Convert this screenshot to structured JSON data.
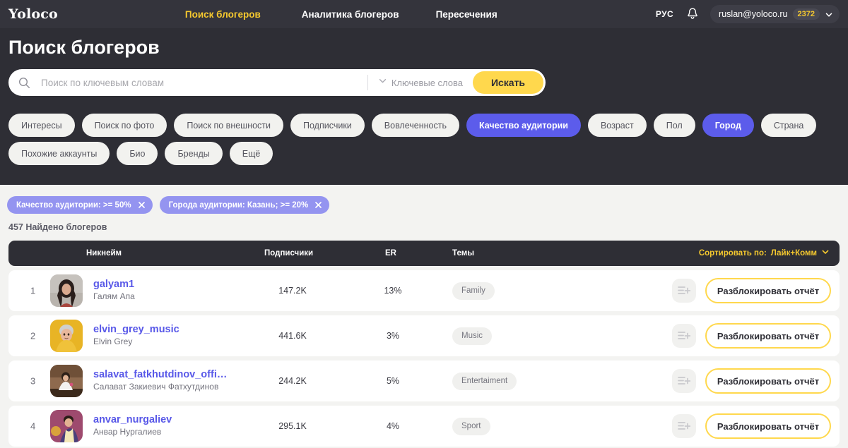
{
  "navbar": {
    "logo": "Yoloco",
    "links": [
      {
        "label": "Поиск блогеров",
        "active": true
      },
      {
        "label": "Аналитика блогеров",
        "active": false
      },
      {
        "label": "Пересечения",
        "active": false
      }
    ],
    "lang": "РУС",
    "bell_icon": "bell-icon",
    "user_email": "ruslan@yoloco.ru",
    "credits": "2372",
    "chevron_icon": "chevron-down-icon"
  },
  "page": {
    "title": "Поиск блогеров",
    "accent_yellow": "#ffd84d",
    "accent_purple": "#5c5ceb",
    "dark_bg": "#2e2e35",
    "page_bg": "#f3f3f1",
    "link_color": "#5858e8"
  },
  "search": {
    "icon": "search-icon",
    "placeholder": "Поиск по ключевым словам",
    "value": "",
    "keyword_select_label": "Ключевые слова",
    "keyword_select_icon": "chevron-down-icon",
    "button_label": "Искать"
  },
  "filters": {
    "row1": [
      {
        "label": "Интересы",
        "active": false
      },
      {
        "label": "Поиск по фото",
        "active": false
      },
      {
        "label": "Поиск по внешности",
        "active": false
      },
      {
        "label": "Подписчики",
        "active": false
      },
      {
        "label": "Вовлеченность",
        "active": false
      },
      {
        "label": "Качество аудитории",
        "active": true
      },
      {
        "label": "Возраст",
        "active": false
      },
      {
        "label": "Пол",
        "active": false
      },
      {
        "label": "Город",
        "active": true
      },
      {
        "label": "Страна",
        "active": false
      }
    ],
    "row2": [
      {
        "label": "Похожие аккаунты",
        "active": false
      },
      {
        "label": "Био",
        "active": false
      },
      {
        "label": "Бренды",
        "active": false
      },
      {
        "label": "Ещё",
        "active": false
      }
    ]
  },
  "applied_tags": [
    {
      "label": "Качество аудитории: >= 50%",
      "remove_icon": "close-icon"
    },
    {
      "label": "Города аудитории: Казань; >= 20%",
      "remove_icon": "close-icon"
    }
  ],
  "results": {
    "count_text": "457 Найдено блогеров",
    "columns": {
      "nickname": "Никнейм",
      "subscribers": "Подписчики",
      "er": "ER",
      "topics": "Темы"
    },
    "sort": {
      "prefix": "Сортировать по:",
      "value": "Лайк+Комм",
      "icon": "chevron-down-icon"
    },
    "rows": [
      {
        "rank": "1",
        "nickname": "galyam1",
        "fullname": "Галям Апа",
        "subscribers": "147.2K",
        "er": "13%",
        "topic": "Family",
        "add_to_list_icon": "list-add-icon",
        "unlock_label": "Разблокировать отчёт",
        "avatar_name": "avatar-galyam1"
      },
      {
        "rank": "2",
        "nickname": "elvin_grey_music",
        "fullname": "Elvin Grey",
        "subscribers": "441.6K",
        "er": "3%",
        "topic": "Music",
        "add_to_list_icon": "list-add-icon",
        "unlock_label": "Разблокировать отчёт",
        "avatar_name": "avatar-elvin-grey"
      },
      {
        "rank": "3",
        "nickname": "salavat_fatkhutdinov_offi…",
        "fullname": "Салават Закиевич Фатхутдинов",
        "subscribers": "244.2K",
        "er": "5%",
        "topic": "Entertaiment",
        "add_to_list_icon": "list-add-icon",
        "unlock_label": "Разблокировать отчёт",
        "avatar_name": "avatar-salavat"
      },
      {
        "rank": "4",
        "nickname": "anvar_nurgaliev",
        "fullname": "Анвар Нургалиев",
        "subscribers": "295.1K",
        "er": "4%",
        "topic": "Sport",
        "add_to_list_icon": "list-add-icon",
        "unlock_label": "Разблокировать отчёт",
        "avatar_name": "avatar-anvar"
      }
    ]
  }
}
